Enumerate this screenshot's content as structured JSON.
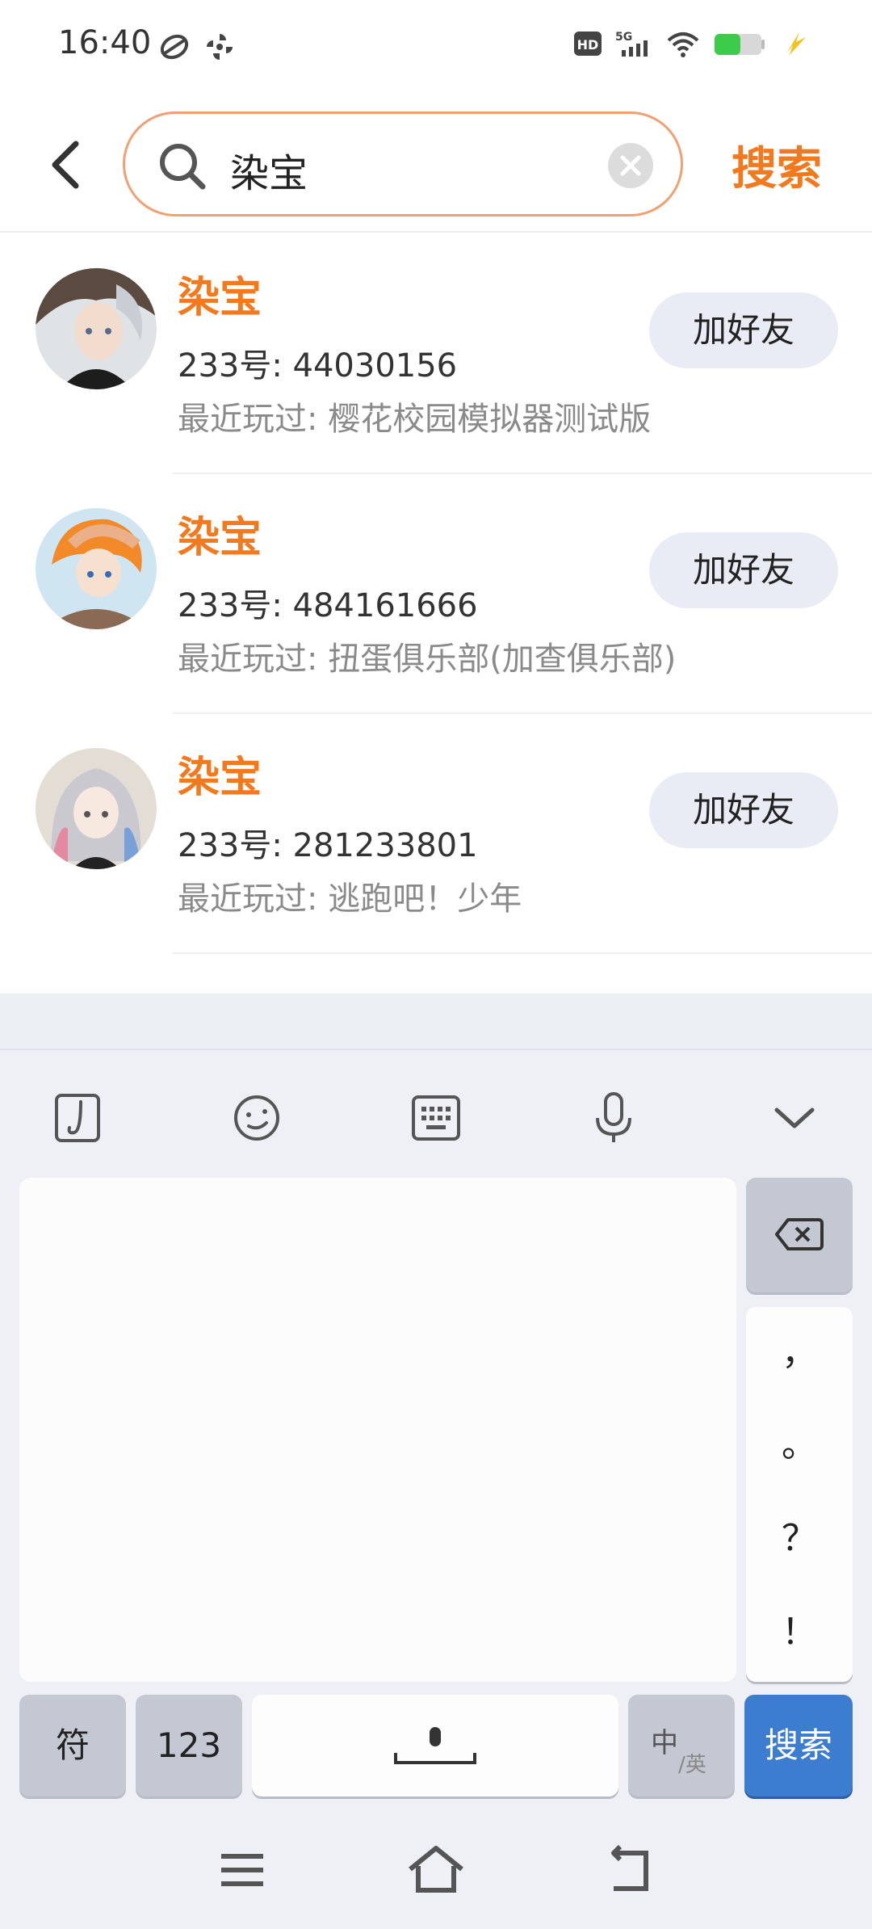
{
  "status_bar": {
    "time": "16:40",
    "left_icons": [
      "game-controller-icon",
      "pinwheel-icon"
    ],
    "right_icons": [
      "hd-icon",
      "5g-signal-icon",
      "wifi-icon",
      "battery-icon",
      "charging-icon"
    ],
    "battery_level": 0.55,
    "battery_color": "#3ccb4a"
  },
  "search": {
    "query": "染宝",
    "action_label": "搜索",
    "accent_color": "#f2791e"
  },
  "results": [
    {
      "name": "染宝",
      "uid": "233号: 44030156",
      "recent": "最近玩过: 樱花校园模拟器测试版",
      "button": "加好友"
    },
    {
      "name": "染宝",
      "uid": "233号: 484161666",
      "recent": "最近玩过: 扭蛋俱乐部(加查俱乐部)",
      "button": "加好友"
    },
    {
      "name": "染宝",
      "uid": "233号: 281233801",
      "recent": "最近玩过: 逃跑吧！少年",
      "button": "加好友"
    }
  ],
  "keyboard": {
    "toolbar_icons": [
      "handwriting-icon",
      "emoji-icon",
      "keyboard-icon",
      "microphone-icon",
      "collapse-chevron-icon"
    ],
    "punctuation": [
      "，",
      "。",
      "？",
      "！"
    ],
    "symbols_key": "符",
    "numbers_key": "123",
    "lang_key_main": "中",
    "lang_key_sub": "/英",
    "enter_key": "搜索"
  },
  "nav_bar": {
    "icons": [
      "menu-icon",
      "home-icon",
      "back-icon"
    ]
  }
}
